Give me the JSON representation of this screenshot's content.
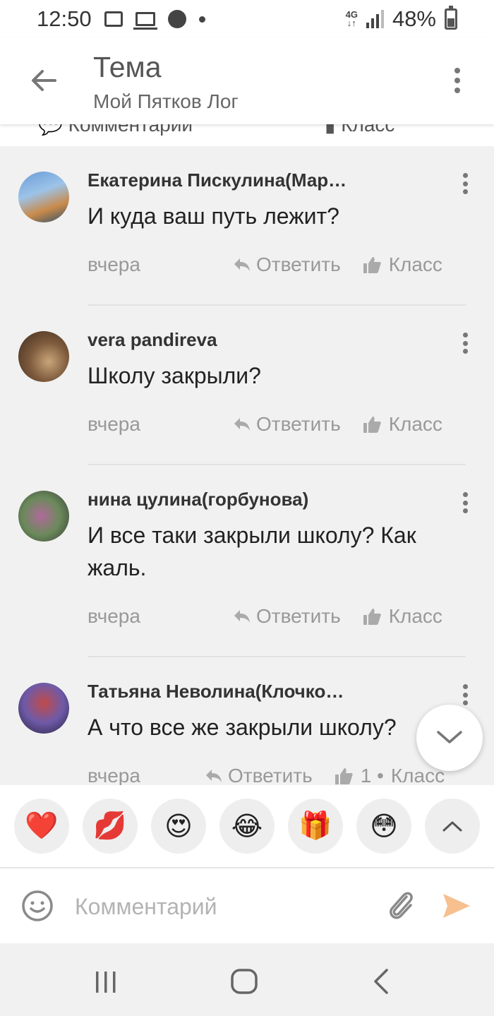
{
  "status_bar": {
    "time": "12:50",
    "network": "4G",
    "battery": "48%",
    "icons": [
      "gallery-icon",
      "laptop-icon",
      "sberbank-icon",
      "dot-icon",
      "signal-icon",
      "battery-icon"
    ]
  },
  "header": {
    "title": "Тема",
    "subtitle": "Мой Пятков Лог"
  },
  "tabs": [
    "Комментарии",
    "Класс"
  ],
  "comments": [
    {
      "author": "Екатерина Пискулина(Мар…",
      "text": "И куда ваш путь лежит?",
      "date": "вчера",
      "reply_label": "Ответить",
      "like_label": "Класс",
      "avatar_colors": [
        "#6a9bd8",
        "#c98a4a",
        "#2d4f6a"
      ]
    },
    {
      "author": "vera pandireva",
      "text": "Школу закрыли?",
      "date": "вчера",
      "reply_label": "Ответить",
      "like_label": "Класс",
      "avatar_colors": [
        "#7d5a3c",
        "#caa57a",
        "#3d2b1f"
      ]
    },
    {
      "author": "нина цулина(горбунова)",
      "text": "И все таки закрыли школу? Как жаль.",
      "date": "вчера",
      "reply_label": "Ответить",
      "like_label": "Класс",
      "avatar_colors": [
        "#6a8a5a",
        "#b06a9a",
        "#3a3a3a"
      ]
    },
    {
      "author": "Татьяна Неволина(Клочко…",
      "text": "А что все же закрыли школу?",
      "date": "вчера",
      "reply_label": "Ответить",
      "like_label": "Класс",
      "like_count": "1 •",
      "avatar_colors": [
        "#2a2340",
        "#c04b4b",
        "#6e5aa8"
      ]
    }
  ],
  "reactions": [
    "❤️",
    "💋",
    "😍",
    "😂",
    "🎁",
    "😳"
  ],
  "input": {
    "placeholder": "Комментарий"
  },
  "colors": {
    "send_accent": "#f6c08f",
    "icon_gray": "#999999",
    "background": "#f1f1f1"
  }
}
